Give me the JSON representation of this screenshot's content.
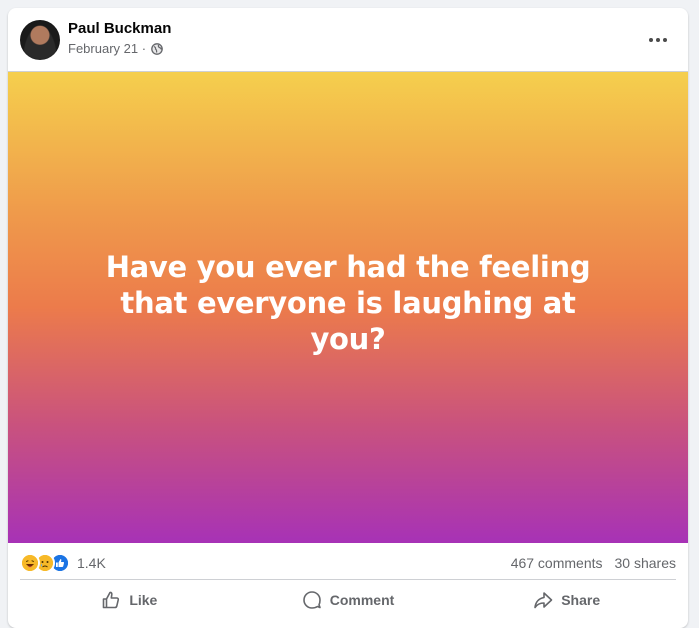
{
  "post": {
    "author": "Paul Buckman",
    "date": "February 21 ·",
    "privacy_icon": "globe-icon",
    "text": "Have you ever had the feeling that everyone is laughing at you?"
  },
  "stats": {
    "reaction_icons": [
      "haha",
      "sad",
      "like"
    ],
    "reaction_count": "1.4K",
    "comments": "467 comments",
    "shares": "30 shares"
  },
  "actions": {
    "like": "Like",
    "comment": "Comment",
    "share": "Share"
  },
  "colors": {
    "gradient_top": "#f5cf4d",
    "gradient_mid": "#ec7b4b",
    "gradient_bottom": "#a732b6",
    "secondary_text": "#65676b"
  }
}
